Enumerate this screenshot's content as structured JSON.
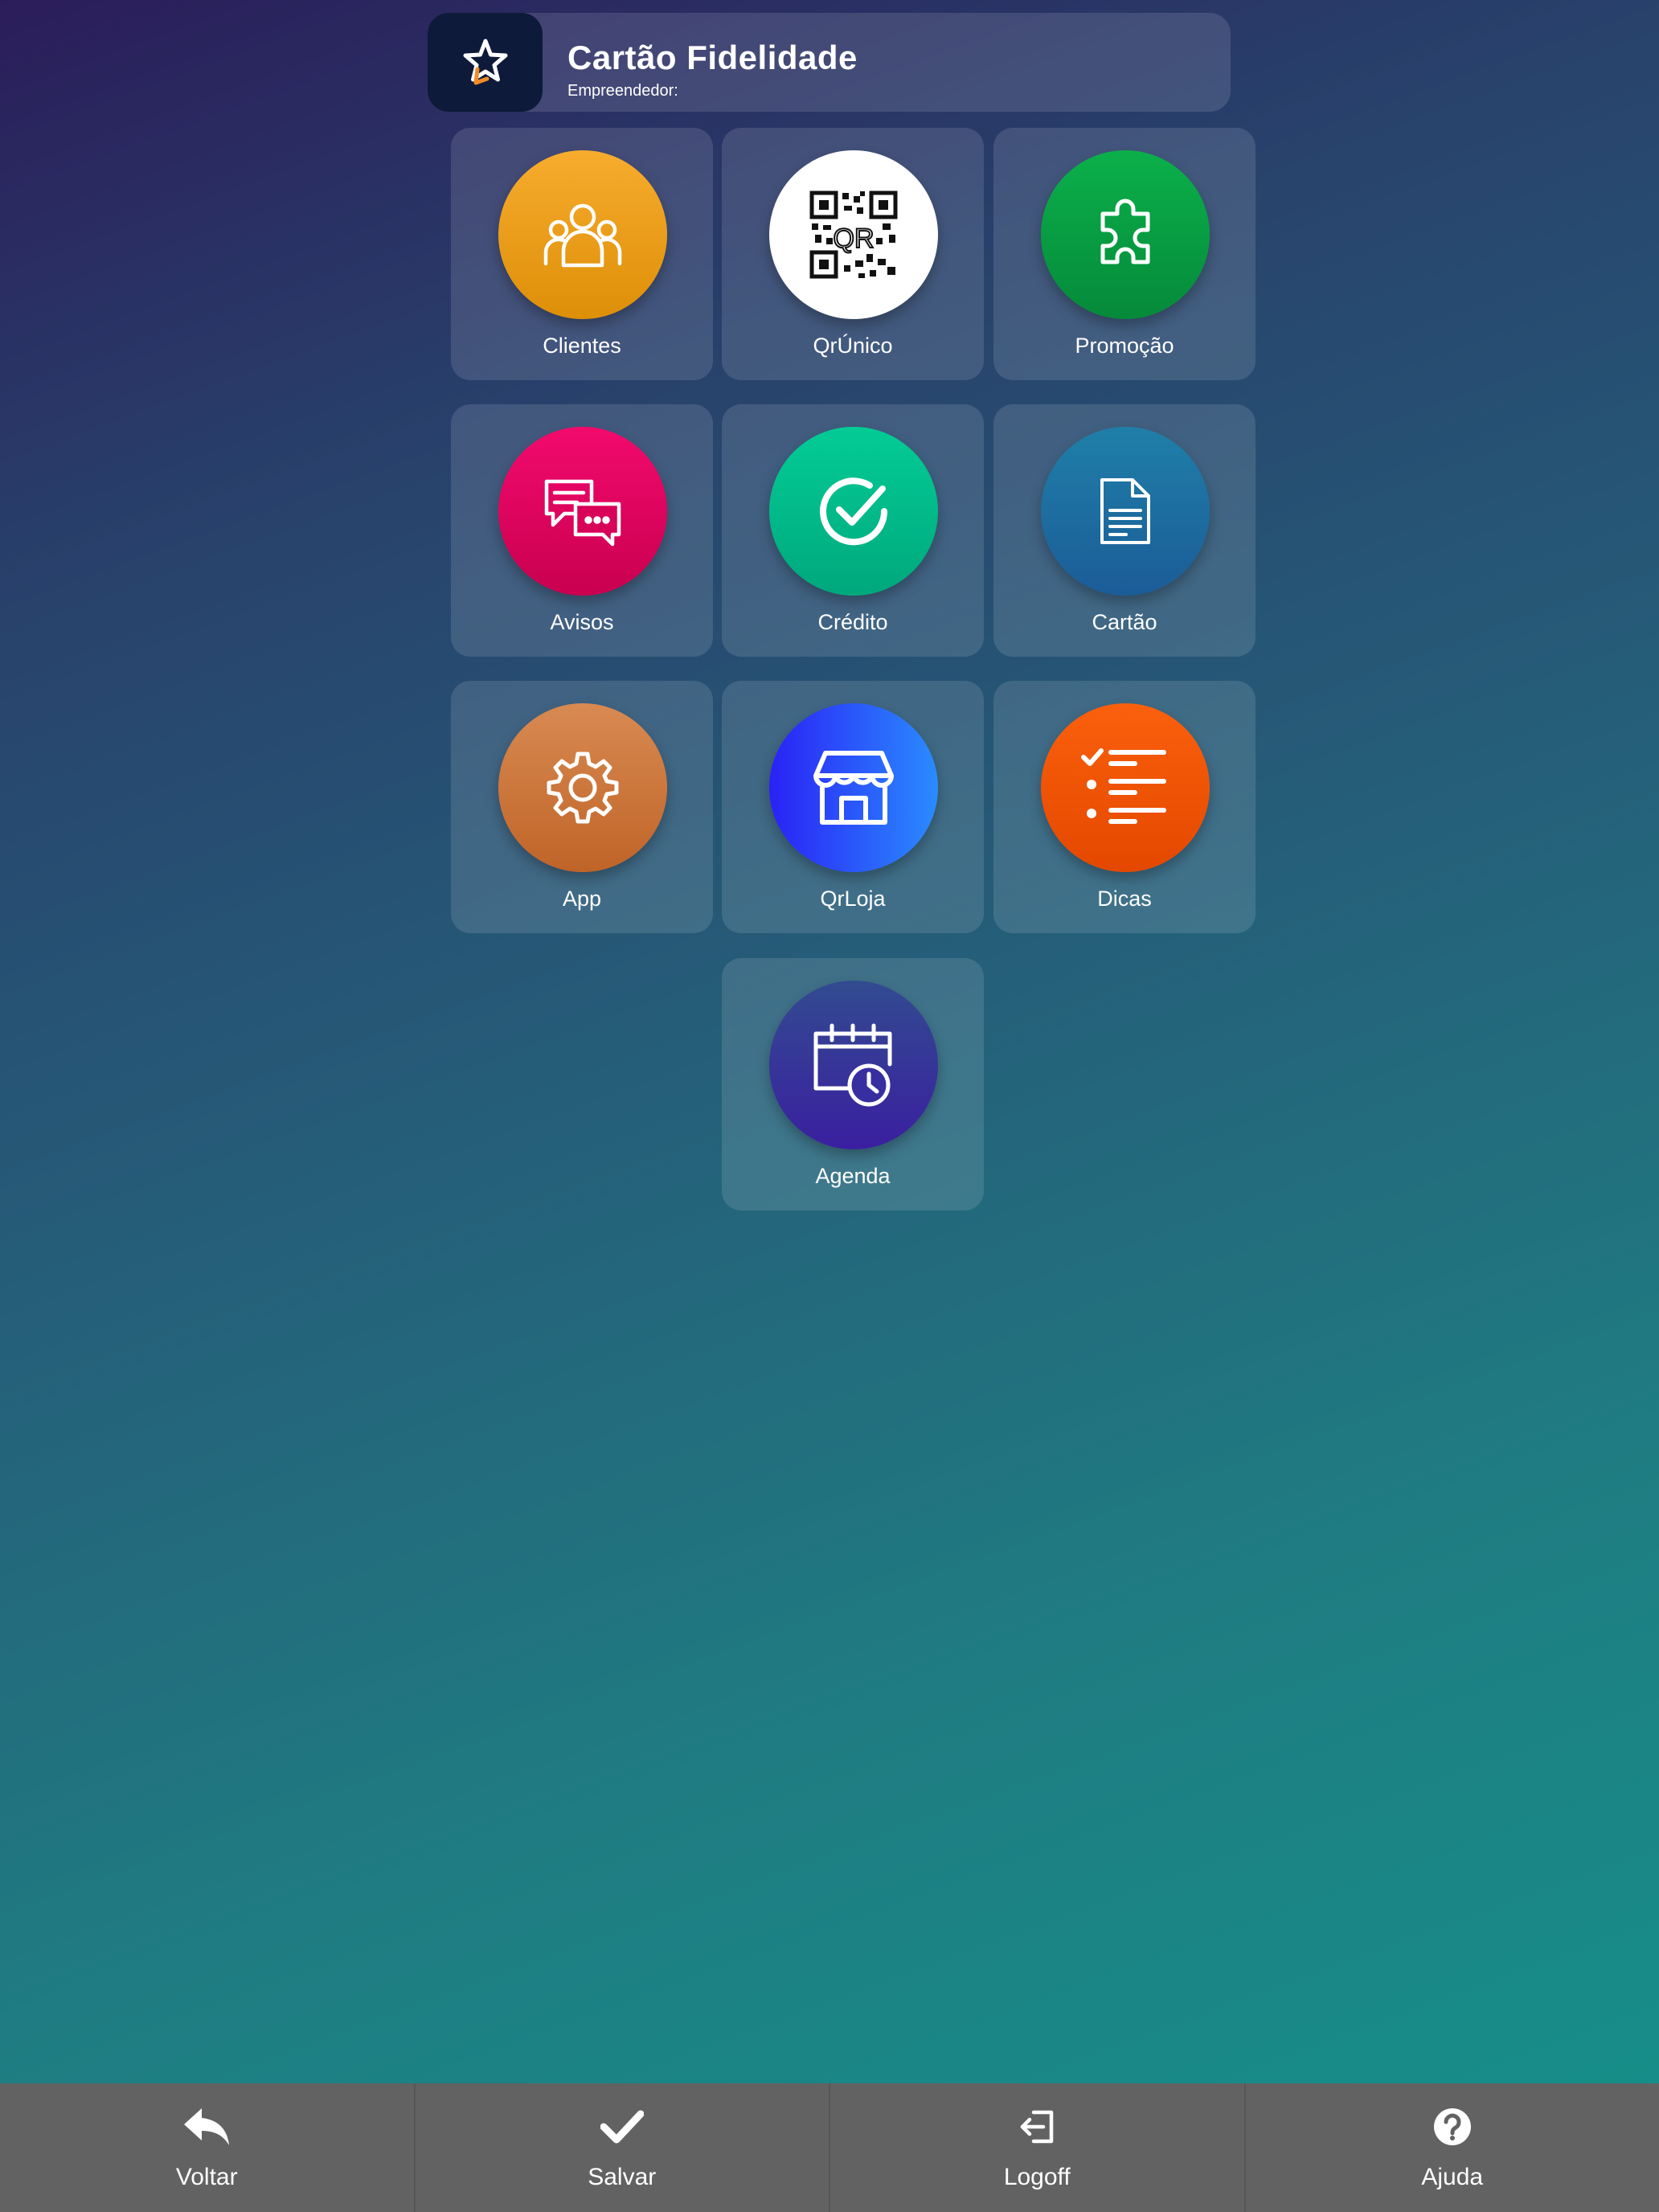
{
  "header": {
    "title": "Cartão Fidelidade",
    "subtitle": "Empreendedor:",
    "logo_icon": "star-logo-icon"
  },
  "tiles": [
    {
      "label": "Clientes",
      "icon": "users-icon",
      "color": "#f5a623"
    },
    {
      "label": "QrÚnico",
      "icon": "qr-code-icon",
      "color": "#ffffff"
    },
    {
      "label": "Promoção",
      "icon": "puzzle-icon",
      "color": "#0aa544"
    },
    {
      "label": "Avisos",
      "icon": "chat-bubbles-icon",
      "color": "#e6005e"
    },
    {
      "label": "Crédito",
      "icon": "check-circle-icon",
      "color": "#00c08f"
    },
    {
      "label": "Cartão",
      "icon": "document-icon",
      "color": "#1f6fa0"
    },
    {
      "label": "App",
      "icon": "gear-icon",
      "color": "#d27a3e"
    },
    {
      "label": "QrLoja",
      "icon": "store-icon",
      "color": "#2a44f5"
    },
    {
      "label": "Dicas",
      "icon": "checklist-icon",
      "color": "#f45a0a"
    },
    {
      "label": "Agenda",
      "icon": "calendar-clock-icon",
      "color": "#3a2f9a"
    }
  ],
  "footer": [
    {
      "label": "Voltar",
      "icon": "reply-arrow-icon"
    },
    {
      "label": "Salvar",
      "icon": "checkmark-icon"
    },
    {
      "label": "Logoff",
      "icon": "logoff-icon"
    },
    {
      "label": "Ajuda",
      "icon": "help-circle-icon"
    }
  ]
}
